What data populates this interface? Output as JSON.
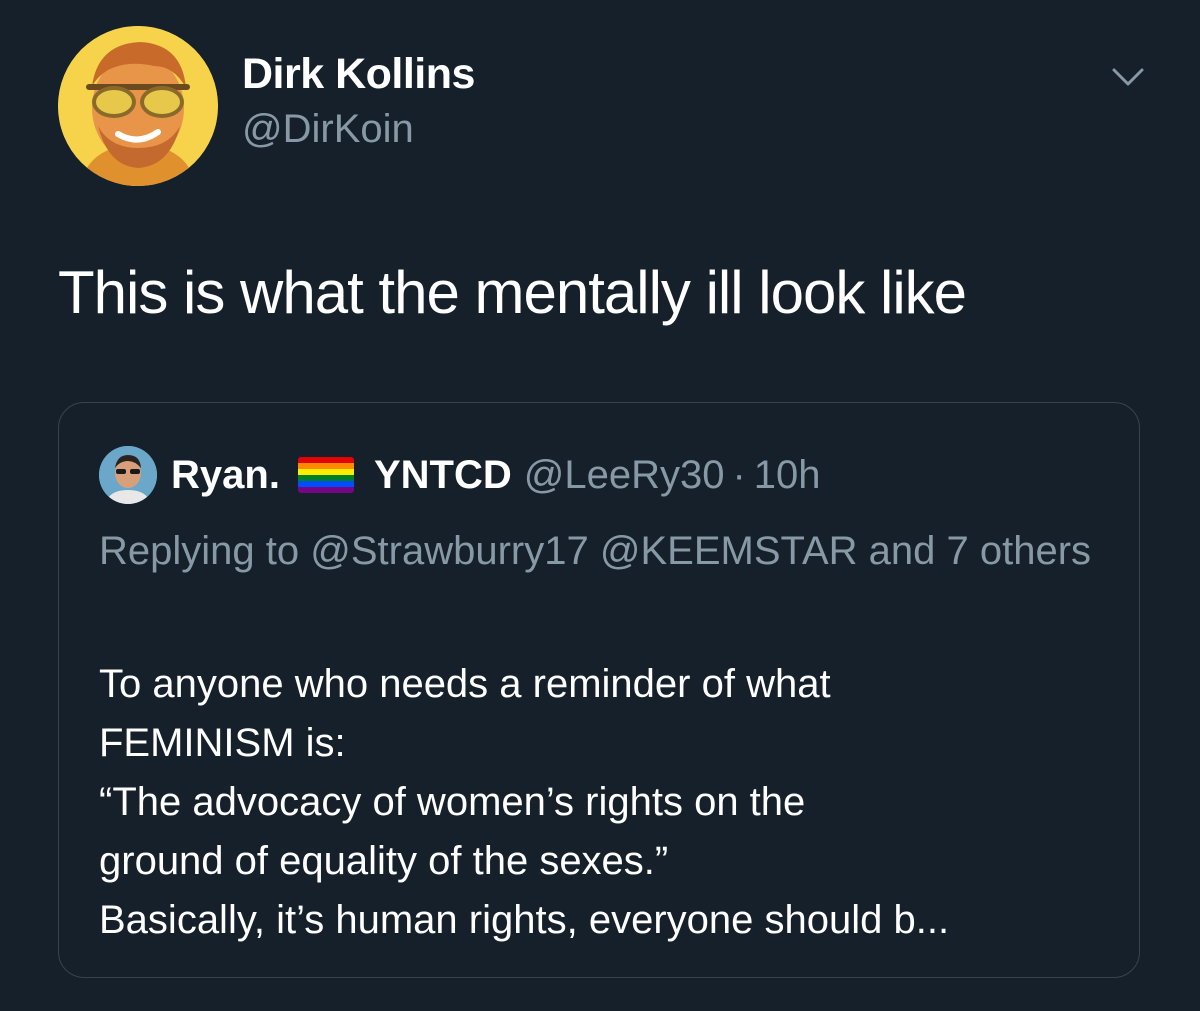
{
  "tweet": {
    "author": {
      "display_name": "Dirk Kollins",
      "handle": "@DirKoin",
      "avatar_icon": "avatar-cartoon-sunglasses"
    },
    "menu_icon": "chevron-down-icon",
    "text": "This is what the mentally ill look like"
  },
  "quoted_tweet": {
    "author": {
      "display_name_part1": "Ryan.",
      "flag_icon": "rainbow-flag-icon",
      "display_name_part2": "YNTCD",
      "handle": "@LeeRy30",
      "separator": "·",
      "time": "10h"
    },
    "replying_to": {
      "prefix": "Replying to",
      "mention1": "@Strawburry17",
      "mention2": "@KEEMSTAR",
      "suffix": "and 7 others"
    },
    "body_lines": [
      "To anyone who needs a reminder of what",
      "FEMINISM is:",
      "“The advocacy of women’s rights on the",
      "ground of equality of the sexes.”",
      "Basically, it’s human rights, everyone should b..."
    ]
  },
  "colors": {
    "background": "#15202b",
    "primary_text": "#ffffff",
    "secondary_text": "#8899a6",
    "border": "#38444d"
  }
}
